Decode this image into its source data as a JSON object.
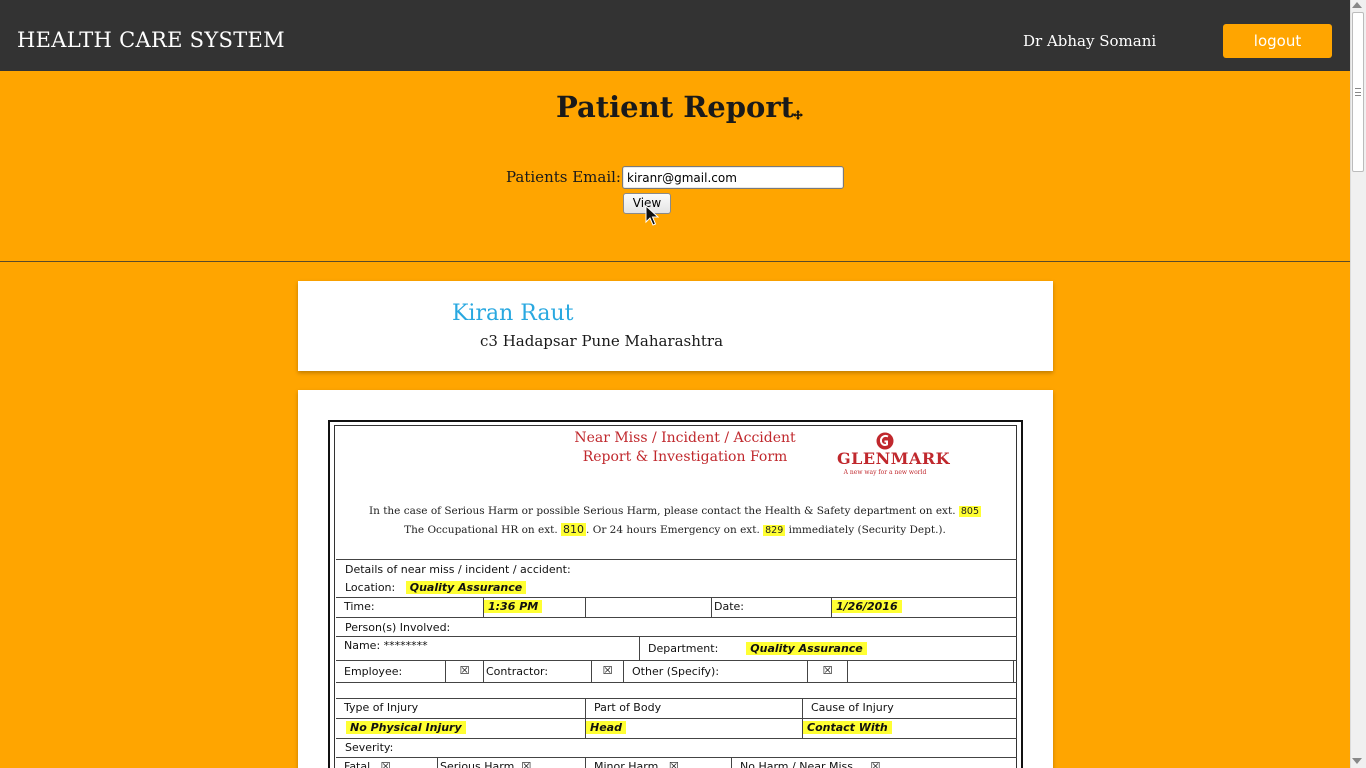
{
  "app": {
    "title": "HEALTH CARE SYSTEM",
    "user_name": "Dr Abhay Somani",
    "logout_label": "logout"
  },
  "header": {
    "page_title": "Patient Report",
    "email_label": "Patients Email:",
    "email_value": "kiranr@gmail.com",
    "view_label": "View"
  },
  "patient": {
    "name": "Kiran Raut",
    "address": "c3 Hadapsar Pune Maharashtra"
  },
  "report": {
    "form_title_line1": "Near Miss / Incident / Accident",
    "form_title_line2": "Report & Investigation Form",
    "logo_text": "GLENMARK",
    "logo_tagline": "A new way for a new world",
    "notice_line1_pre": "In the case of Serious Harm or possible Serious Harm, please contact the Health & Safety department on ext.",
    "notice_ext1": "805",
    "notice_line2_pre": "The Occupational HR on ext.",
    "notice_ext2": "810",
    "notice_line2_mid": ". Or 24 hours Emergency on ext.",
    "notice_ext3": "829",
    "notice_line2_post": "immediately (Security Dept.).",
    "details_label": "Details of near miss / incident / accident:",
    "location_label": "Location:",
    "location_value": "Quality Assurance",
    "time_label": "Time:",
    "time_value": "1:36 PM",
    "date_label": "Date:",
    "date_value": "1/26/2016",
    "persons_label": "Person(s) Involved:",
    "name_label": "Name: ********",
    "department_label": "Department:",
    "department_value": "Quality Assurance",
    "employee_label": "Employee:",
    "contractor_label": "Contractor:",
    "other_label": "Other (Specify):",
    "checkbox_mark": "☒",
    "type_injury_label": "Type of Injury",
    "part_body_label": "Part of Body",
    "cause_injury_label": "Cause of Injury",
    "type_injury_value": "No Physical Injury",
    "part_body_value": "Head",
    "cause_injury_value": "Contact With",
    "severity_label": "Severity:",
    "fatal_label": "Fatal",
    "serious_label": "Serious Harm",
    "minor_label": "Minor Harm",
    "noharm_label": "No Harm / Near Miss"
  },
  "colors": {
    "topbar": "#333333",
    "accent": "#ffa500",
    "patient_name": "#29a8e0",
    "form_title": "#c0282d",
    "highlight": "#ffff33"
  }
}
